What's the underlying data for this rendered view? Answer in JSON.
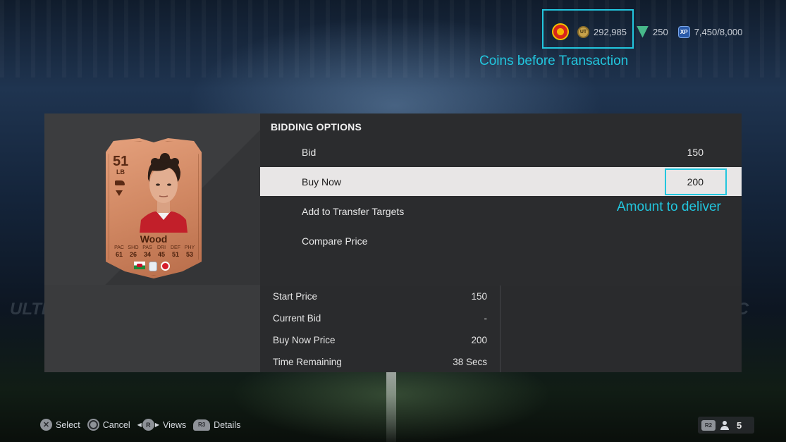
{
  "header": {
    "coins": "292,985",
    "points": "250",
    "xp": "7,450/8,000",
    "coin_icon_text": "UT",
    "xp_icon_text": "XP"
  },
  "annotations": {
    "coins_label": "Coins before Transaction",
    "amount_label": "Amount to deliver",
    "color": "#22c6de"
  },
  "bidding": {
    "title": "BIDDING OPTIONS",
    "items": [
      {
        "label": "Bid",
        "value": "150"
      },
      {
        "label": "Buy Now",
        "value": "200"
      },
      {
        "label": "Add to Transfer Targets",
        "value": ""
      },
      {
        "label": "Compare Price",
        "value": ""
      }
    ]
  },
  "auction": {
    "rows": [
      {
        "label": "Start Price",
        "value": "150"
      },
      {
        "label": "Current Bid",
        "value": "-"
      },
      {
        "label": "Buy Now Price",
        "value": "200"
      },
      {
        "label": "Time Remaining",
        "value": "38 Secs"
      }
    ]
  },
  "player_card": {
    "rating": "51",
    "position": "LB",
    "name": "Wood",
    "stats": [
      {
        "k": "PAC",
        "v": "61"
      },
      {
        "k": "SHO",
        "v": "26"
      },
      {
        "k": "PAS",
        "v": "34"
      },
      {
        "k": "DRI",
        "v": "45"
      },
      {
        "k": "DEF",
        "v": "51"
      },
      {
        "k": "PHY",
        "v": "53"
      }
    ]
  },
  "controls": {
    "select": "Select",
    "cancel": "Cancel",
    "views": "Views",
    "details": "Details",
    "views_button": "R",
    "details_button": "R3"
  },
  "social": {
    "button": "R2",
    "count": "5"
  }
}
